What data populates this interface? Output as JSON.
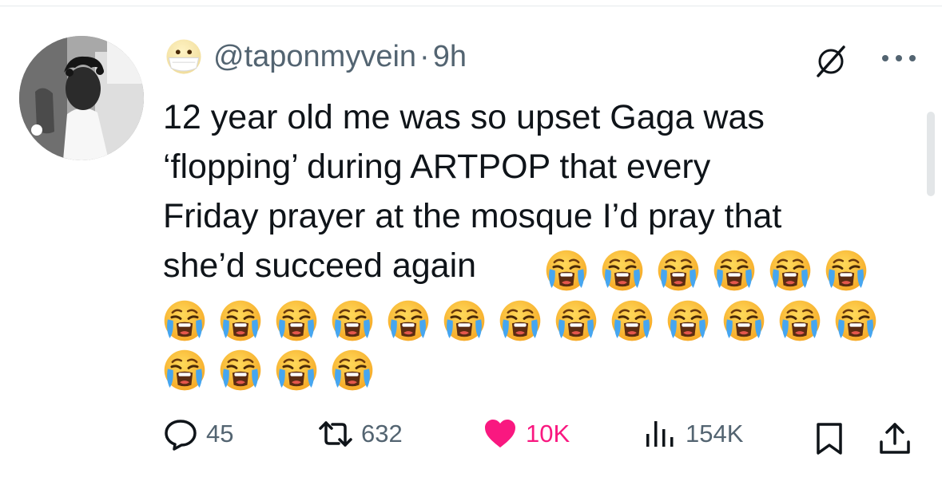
{
  "tweet": {
    "author": {
      "handle": "@taponmyvein",
      "avatar_icon": "user-avatar-photo",
      "badge_emoji": "face-with-medical-mask"
    },
    "separator": "·",
    "time": "9h",
    "text": "12 year old me was so upset Gaga was\n‘flopping’ during ARTPOP that every\nFriday prayer at the mosque I’d pray that\nshe’d succeed again",
    "emoji": {
      "name": "loudly-crying-face",
      "count": 22
    },
    "header_icons": [
      "null-icon",
      "more-icon"
    ]
  },
  "actions": {
    "replies": "45",
    "reposts": "632",
    "likes": "10K",
    "views": "154K",
    "icons": [
      "reply-icon",
      "repost-icon",
      "heart-icon",
      "views-icon",
      "bookmark-icon",
      "share-icon"
    ]
  },
  "colors": {
    "text": "#0f1419",
    "muted": "#536471",
    "like": "#f91880",
    "divider": "#e6e9ec"
  }
}
